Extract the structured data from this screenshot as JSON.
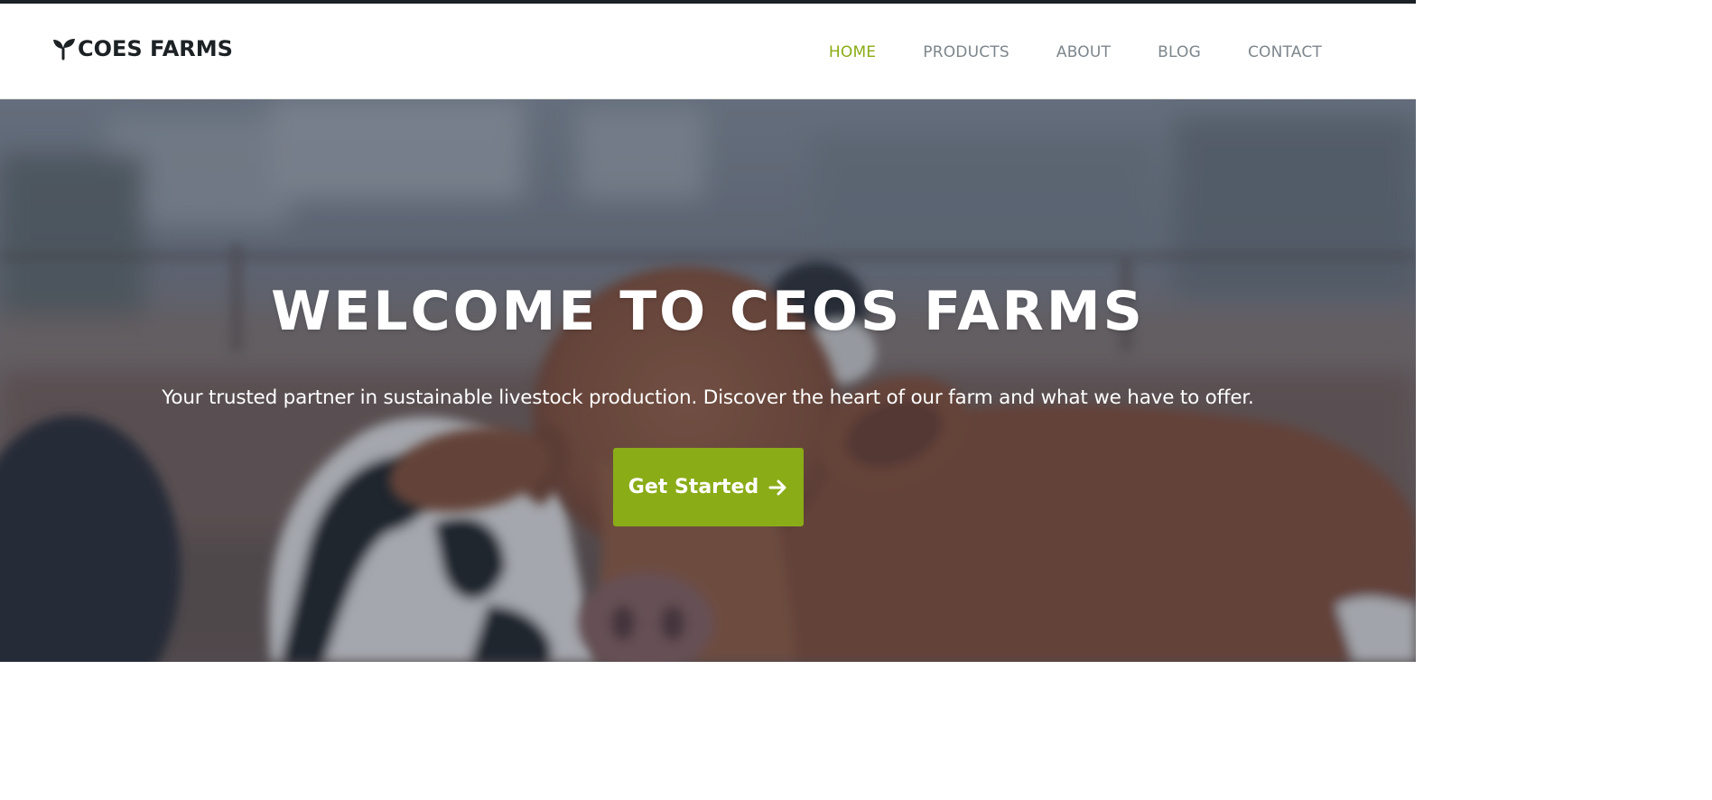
{
  "header": {
    "brand_name": "COES FARMS",
    "brand_icon": "sprout-icon",
    "nav": [
      {
        "label": "HOME",
        "active": true
      },
      {
        "label": "PRODUCTS",
        "active": false
      },
      {
        "label": "ABOUT",
        "active": false
      },
      {
        "label": "BLOG",
        "active": false
      },
      {
        "label": "CONTACT",
        "active": false
      }
    ]
  },
  "hero": {
    "title": "WELCOME TO CEOS FARMS",
    "subtitle": "Your trusted partner in sustainable livestock production. Discover the heart of our farm and what we have to offer.",
    "cta_label": "Get Started",
    "cta_icon": "arrow-right-icon",
    "background_image": "blurred-cows-in-pasture-photo"
  },
  "colors": {
    "accent": "#8aac15",
    "nav_text": "#7d868c",
    "brand_text": "#1c2124",
    "topbar": "#1b2225"
  }
}
